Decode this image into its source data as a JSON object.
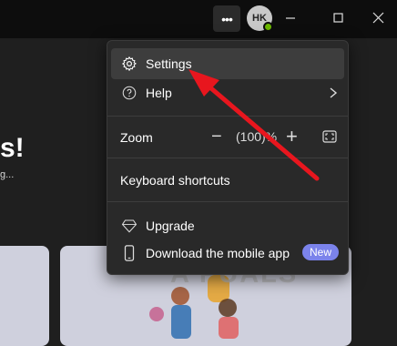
{
  "titlebar": {
    "more_label": "•••",
    "avatar_initials": "HK",
    "presence_color": "#6bb700"
  },
  "background": {
    "hero_line1": "s!",
    "hero_line2": "g..."
  },
  "menu": {
    "settings_label": "Settings",
    "help_label": "Help",
    "zoom_label": "Zoom",
    "zoom_minus": "−",
    "zoom_value": "(100)%",
    "zoom_plus": "+",
    "shortcuts_label": "Keyboard shortcuts",
    "upgrade_label": "Upgrade",
    "download_label": "Download the mobile app",
    "new_badge": "New"
  },
  "icons": {
    "settings": "gear-icon",
    "help": "question-circle-icon",
    "upgrade": "diamond-icon",
    "download": "phone-icon",
    "fullscreen": "fullscreen-icon"
  },
  "colors": {
    "accent": "#7b83eb",
    "arrow": "#e8161e"
  },
  "watermark": {
    "text": "A  PUALS"
  }
}
